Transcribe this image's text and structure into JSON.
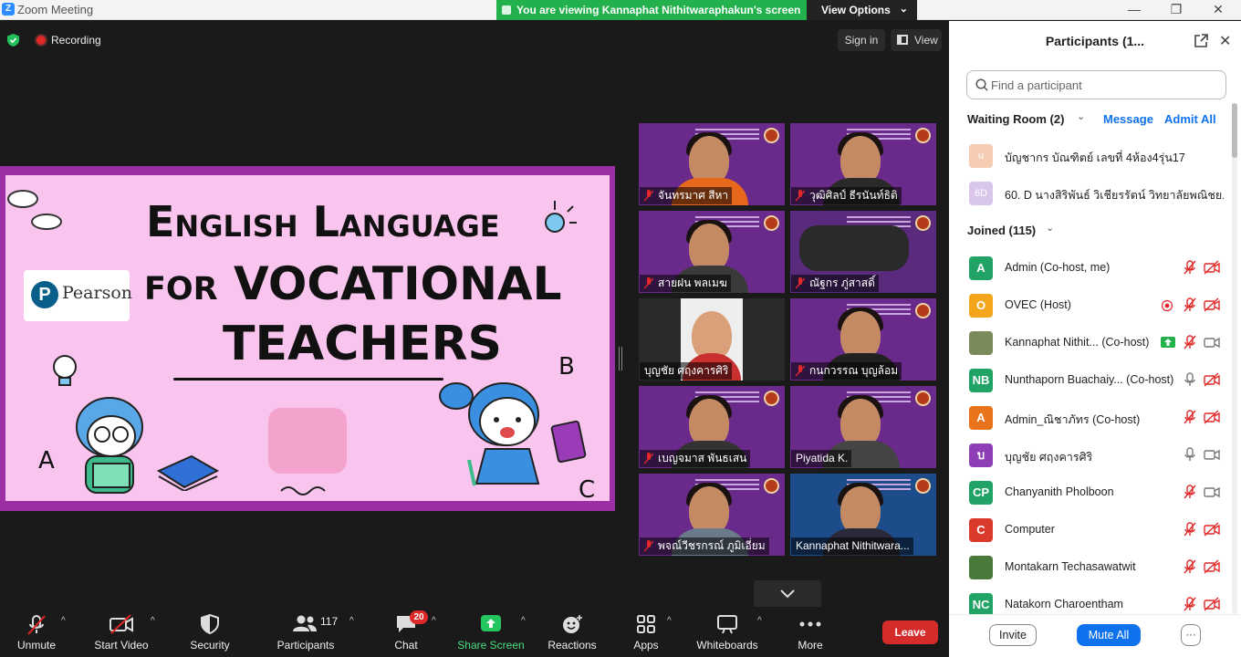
{
  "window": {
    "title": "Zoom Meeting",
    "logo": "Z"
  },
  "share_banner": "You are viewing Kannaphat Nithitwaraphakun's screen",
  "view_options": "View Options",
  "topbar": {
    "recording": "Recording",
    "sign_in": "Sign in",
    "view": "View"
  },
  "slide": {
    "line1": "English Language",
    "line2": "for VOCATIONAL",
    "line3": "TEACHERS",
    "brand": "Pearson",
    "brand_letter": "P",
    "letters": [
      "A",
      "B",
      "C"
    ]
  },
  "videos": [
    {
      "name": "จันทรมาศ สีหา",
      "muted": true
    },
    {
      "name": "วุฒิศิลป์ ธีรนันท์ธิติ",
      "muted": true
    },
    {
      "name": "สายฝน พลเมฆ",
      "muted": true
    },
    {
      "name": "ณัฐกร ภู่สาสดิ์",
      "muted": true
    },
    {
      "name": "บุญชัย ศฤงคารศิริ",
      "muted": false
    },
    {
      "name": "กนกวรรณ บุญล้อม",
      "muted": true
    },
    {
      "name": "เบญจมาส พันธเสน",
      "muted": true
    },
    {
      "name": "Piyatida K.",
      "muted": false
    },
    {
      "name": "พจณ์วีชรกรณ์ ภูมิเอี่ยม",
      "muted": true
    },
    {
      "name": "Kannaphat Nithitwara...",
      "muted": false
    }
  ],
  "toolbar": {
    "unmute": "Unmute",
    "start_video": "Start Video",
    "security": "Security",
    "participants": "Participants",
    "participants_count": "117",
    "chat": "Chat",
    "chat_badge": "20",
    "share_screen": "Share Screen",
    "reactions": "Reactions",
    "apps": "Apps",
    "whiteboards": "Whiteboards",
    "more": "More",
    "leave": "Leave"
  },
  "panel": {
    "title": "Participants (1...",
    "search_placeholder": "Find a participant",
    "waiting_title": "Waiting Room (2)",
    "message": "Message",
    "admit_all": "Admit All",
    "waiting": [
      {
        "initials": "u",
        "name": "บัญชากร บัณฑิตย์ เลขที่ 4ห้อง4รุ่น17",
        "color": "#f6cdb3"
      },
      {
        "initials": "6D",
        "name": "60. D นางสิริพันธ์ วิเชียรรัตน์ วิทยาลัยพณิชย...",
        "color": "#d9c6ea"
      }
    ],
    "joined_title": "Joined (115)",
    "joined": [
      {
        "initials": "A",
        "name": "Admin (Co-host, me)",
        "color": "#21a366",
        "mic": "muted",
        "cam": "off"
      },
      {
        "initials": "O",
        "name": "OVEC (Host)",
        "color": "#f3a51b",
        "mic": "muted",
        "cam": "off",
        "extra": "record-icon"
      },
      {
        "initials": "",
        "name": "Kannaphat Nithit...  (Co-host)",
        "color": "#7a8a5a",
        "mic": "muted",
        "cam": "on",
        "extra": "share-screen-icon"
      },
      {
        "initials": "NB",
        "name": "Nunthaporn Buachaiy... (Co-host)",
        "color": "#21a366",
        "mic": "on",
        "cam": "off"
      },
      {
        "initials": "A",
        "name": "Admin_ณิชาภัทร (Co-host)",
        "color": "#e8731b",
        "mic": "muted",
        "cam": "off"
      },
      {
        "initials": "บ",
        "name": "บุญชัย ศฤงคารศิริ",
        "color": "#8e3fb5",
        "mic": "on",
        "cam": "on"
      },
      {
        "initials": "CP",
        "name": "Chanyanith Pholboon",
        "color": "#21a366",
        "mic": "muted",
        "cam": "on"
      },
      {
        "initials": "C",
        "name": "Computer",
        "color": "#d93a2b",
        "mic": "muted",
        "cam": "off"
      },
      {
        "initials": "",
        "name": "Montakarn Techasawatwit",
        "color": "#4a7a3a",
        "mic": "muted",
        "cam": "off"
      },
      {
        "initials": "NC",
        "name": "Natakorn Charoentham",
        "color": "#21a366",
        "mic": "muted",
        "cam": "off"
      }
    ],
    "invite": "Invite",
    "mute_all": "Mute All",
    "more": "···"
  }
}
